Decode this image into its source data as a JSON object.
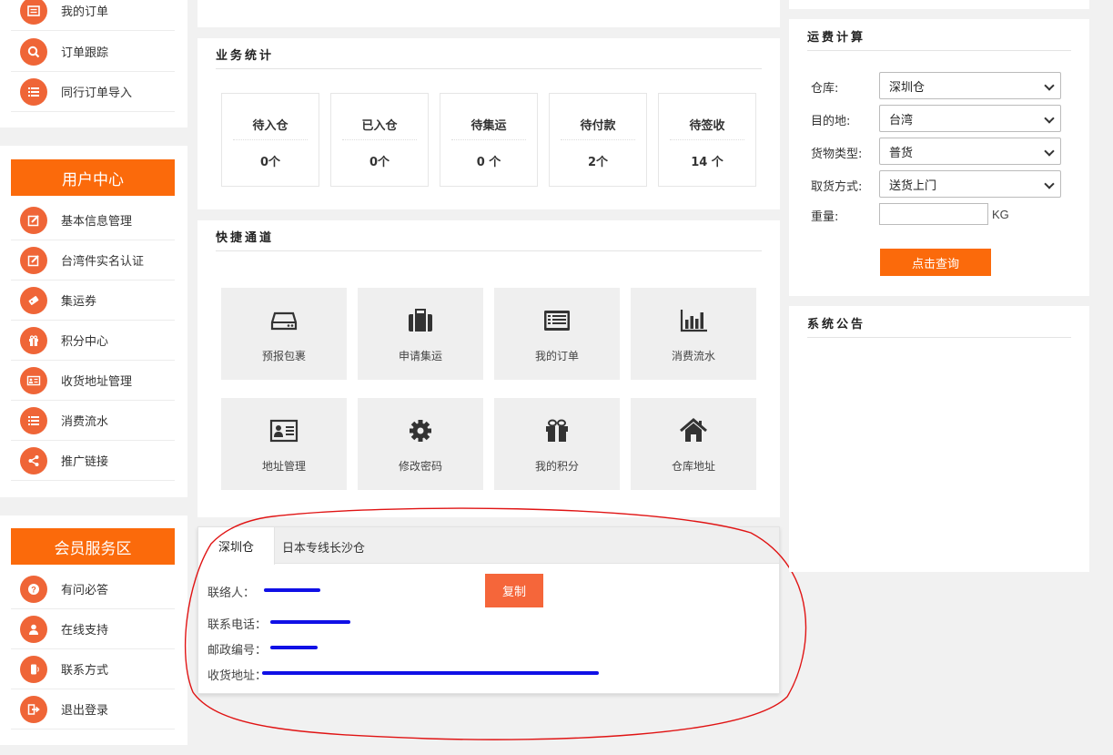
{
  "sidebar": {
    "top_items": [
      {
        "label": "我的订单",
        "icon": "list-icon"
      },
      {
        "label": "订单跟踪",
        "icon": "search-icon"
      },
      {
        "label": "同行订单导入",
        "icon": "list-icon"
      }
    ],
    "user_center": {
      "title": "用户中心",
      "items": [
        {
          "label": "基本信息管理",
          "icon": "edit-icon"
        },
        {
          "label": "台湾件实名认证",
          "icon": "edit-icon"
        },
        {
          "label": "集运券",
          "icon": "ticket-icon"
        },
        {
          "label": "积分中心",
          "icon": "gift-icon"
        },
        {
          "label": "收货地址管理",
          "icon": "address-card-icon"
        },
        {
          "label": "消费流水",
          "icon": "list-icon"
        },
        {
          "label": "推广链接",
          "icon": "share-icon"
        }
      ]
    },
    "member_service": {
      "title": "会员服务区",
      "items": [
        {
          "label": "有问必答",
          "icon": "question-icon"
        },
        {
          "label": "在线支持",
          "icon": "user-icon"
        },
        {
          "label": "联系方式",
          "icon": "phone-icon"
        },
        {
          "label": "退出登录",
          "icon": "logout-icon"
        }
      ]
    }
  },
  "stats": {
    "title": "业务统计",
    "items": [
      {
        "label": "待入仓",
        "value": "0个"
      },
      {
        "label": "已入仓",
        "value": "0个"
      },
      {
        "label": "待集运",
        "value": "0 个"
      },
      {
        "label": "待付款",
        "value": "2个"
      },
      {
        "label": "待签收",
        "value": "14 个"
      }
    ]
  },
  "shortcuts": {
    "title": "快捷通道",
    "items": [
      {
        "label": "预报包裹",
        "icon": "hdd-icon"
      },
      {
        "label": "申请集运",
        "icon": "briefcase-icon"
      },
      {
        "label": "我的订单",
        "icon": "list-alt-icon"
      },
      {
        "label": "消费流水",
        "icon": "bar-chart-icon"
      },
      {
        "label": "地址管理",
        "icon": "address-card-icon"
      },
      {
        "label": "修改密码",
        "icon": "gear-icon"
      },
      {
        "label": "我的积分",
        "icon": "gift-icon"
      },
      {
        "label": "仓库地址",
        "icon": "home-icon"
      }
    ]
  },
  "warehouse": {
    "tabs": [
      "深圳仓",
      "日本专线长沙仓"
    ],
    "active_tab": "深圳仓",
    "contact_label": "联络人：",
    "phone_label": "联系电话：",
    "postcode_label": "邮政编号：",
    "address_label": "收货地址：",
    "copy_button": "复制"
  },
  "calculator": {
    "title": "运费计算",
    "warehouse_label": "仓库:",
    "warehouse_value": "深圳仓",
    "destination_label": "目的地:",
    "destination_value": "台湾",
    "cargo_label": "货物类型:",
    "cargo_value": "普货",
    "pickup_label": "取货方式:",
    "pickup_value": "送货上门",
    "weight_label": "重量:",
    "weight_value": "",
    "weight_unit": "KG",
    "query_button": "点击查询"
  },
  "announcement": {
    "title": "系统公告"
  },
  "colors": {
    "accent": "#fb6a0b",
    "icon_circle": "#ef6537",
    "annotation_red": "#e01414",
    "scribble_blue": "#1010e6"
  }
}
